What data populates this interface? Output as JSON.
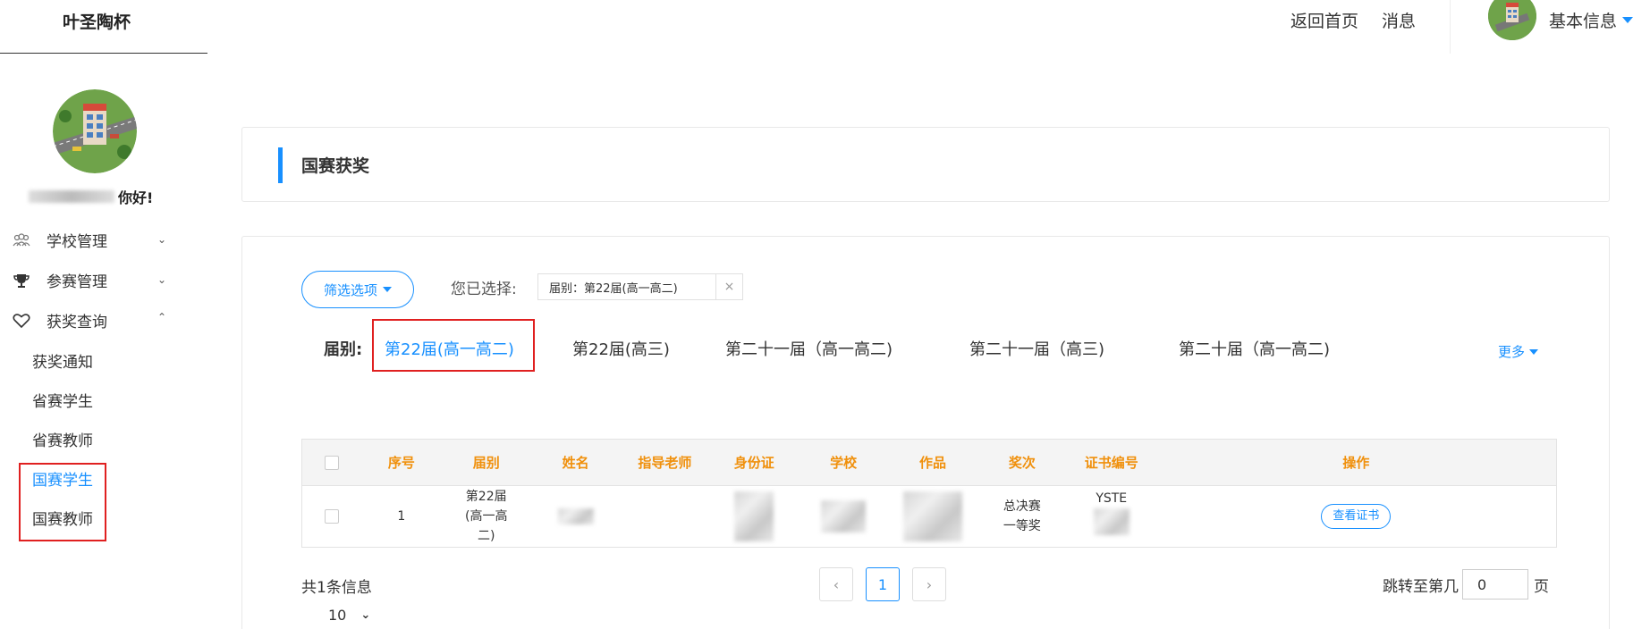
{
  "header": {
    "brand": "叶圣陶杯",
    "nav": [
      "返回首页",
      "消息"
    ],
    "user_label": "基本信息"
  },
  "sidebar": {
    "greeting": "你好!",
    "menu": [
      {
        "label": "学校管理",
        "icon": "users-icon",
        "expanded": false
      },
      {
        "label": "参赛管理",
        "icon": "trophy-icon",
        "expanded": false
      },
      {
        "label": "获奖查询",
        "icon": "heart-icon",
        "expanded": true
      }
    ],
    "submenu": [
      {
        "label": "获奖通知",
        "active": false
      },
      {
        "label": "省赛学生",
        "active": false
      },
      {
        "label": "省赛教师",
        "active": false
      },
      {
        "label": "国赛学生",
        "active": true
      },
      {
        "label": "国赛教师",
        "active": false
      }
    ]
  },
  "panel": {
    "title": "国赛获奖"
  },
  "filter": {
    "button_label": "筛选选项",
    "selected_label": "您已选择:",
    "chip_text": "届别：第22届(高一高二)",
    "chip_close": "×",
    "term_label": "届别:",
    "terms": [
      "第22届(高一高二)",
      "第22届(高三)",
      "第二十一届（高一高二)",
      "第二十一届（高三)",
      "第二十届（高一高二)"
    ],
    "active_term_index": 0,
    "more_label": "更多"
  },
  "table": {
    "columns": [
      "序号",
      "届别",
      "姓名",
      "指导老师",
      "身份证",
      "学校",
      "作品",
      "奖次",
      "证书编号",
      "操作"
    ],
    "rows": [
      {
        "index": "1",
        "term": "第22届(高一高二)",
        "teacher": "",
        "award": "总决赛一等奖",
        "cert_prefix": "YSTE",
        "action": "查看证书"
      }
    ]
  },
  "pagination": {
    "total_text": "共1条信息",
    "page_size": "10",
    "prev": "‹",
    "current_page": "1",
    "next": "›",
    "jump_label": "跳转至第几",
    "jump_value": "0",
    "jump_suffix": "页"
  },
  "colors": {
    "accent": "#1890ff",
    "header_text": "#f0900c",
    "highlight_box": "#e02020"
  }
}
